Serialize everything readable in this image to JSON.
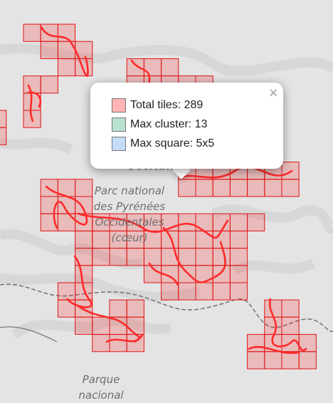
{
  "map": {
    "labels": {
      "pyrenees": [
        "Parc national",
        "des Pyrénées",
        "Occidentales",
        "(cœur)"
      ],
      "parque": [
        "Parque",
        "nacional"
      ],
      "occitanie": "Occitanie"
    },
    "colors": {
      "land": "#e4e4e4",
      "relief": "#d2d2d2",
      "tile_fill": "rgba(255,0,0,0.18)",
      "tile_border": "#e01515",
      "track": "#ff2a2a",
      "border_line": "#777777"
    }
  },
  "popup": {
    "rows": [
      {
        "label": "Total tiles: 289",
        "swatch_color": "#ffb3b3"
      },
      {
        "label": "Max cluster: 13",
        "swatch_color": "#b7e2cf"
      },
      {
        "label": "Max square: 5x5",
        "swatch_color": "#c4dcf7"
      }
    ],
    "close_glyph": "×"
  }
}
